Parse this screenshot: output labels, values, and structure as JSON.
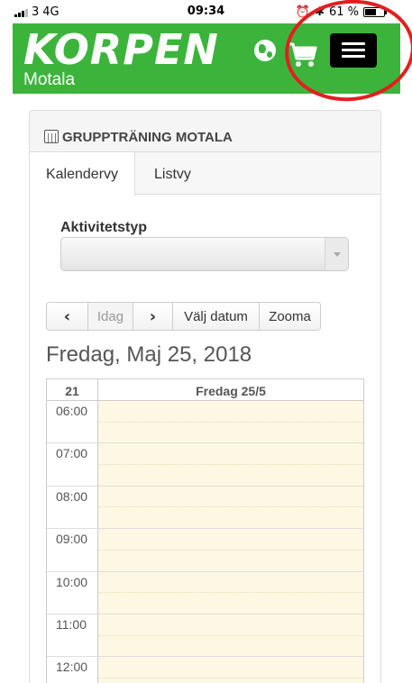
{
  "status_bar": {
    "carrier": "3",
    "network": "4G",
    "time": "09:34",
    "battery": "61 %",
    "battery_level": 0.61
  },
  "header": {
    "logo": "KORPEN",
    "logo_sub": "Motala",
    "brand_color": "#3cb43c"
  },
  "panel": {
    "title": "GRUPPTRÄNING MOTALA",
    "tabs": [
      "Kalendervy",
      "Listvy"
    ],
    "activity_label": "Aktivitetstyp",
    "activity_value": "",
    "nav": {
      "today": "Idag",
      "pick_date": "Välj datum",
      "zoom": "Zooma"
    },
    "date_title": "Fredag, Maj 25, 2018",
    "calendar": {
      "week_number": "21",
      "day_header": "Fredag 25/5",
      "hours": [
        "06:00",
        "07:00",
        "08:00",
        "09:00",
        "10:00",
        "11:00",
        "12:00"
      ]
    }
  }
}
